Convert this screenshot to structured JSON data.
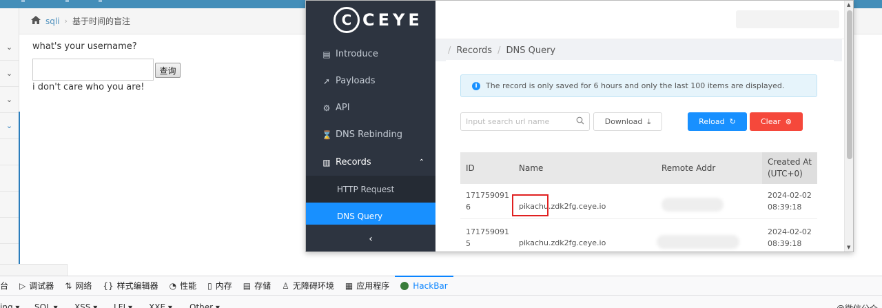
{
  "pikachu": {
    "breadcrumb": {
      "home_icon": "home-icon",
      "link": "sqli",
      "separator": "›",
      "current": "基于时间的盲注"
    },
    "sidebar_chevrons": [
      "⌄",
      "⌄",
      "⌄",
      "⌄"
    ],
    "question": "what's your username?",
    "input_value": "",
    "submit_label": "查询",
    "result": "i don't care who you are!"
  },
  "ceye": {
    "logo_mark": "C",
    "logo_text": "CEYE",
    "nav": [
      {
        "label": "Introduce",
        "icon": "book-icon"
      },
      {
        "label": "Payloads",
        "icon": "rocket-icon"
      },
      {
        "label": "API",
        "icon": "api-icon"
      },
      {
        "label": "DNS Rebinding",
        "icon": "hourglass-icon"
      },
      {
        "label": "Records",
        "icon": "records-icon"
      }
    ],
    "records_caret": "⌃",
    "subnav": {
      "http": "HTTP Request",
      "dns": "DNS Query"
    },
    "collapse_label": "‹",
    "crumb": {
      "sep": "/",
      "records": "Records",
      "current": "DNS Query"
    },
    "info_text": "The record is only saved for 6 hours and only the last 100 items are displayed.",
    "info_icon": "i",
    "search_placeholder": "Input search url name",
    "search_icon": "⌕",
    "download_label": "Download",
    "download_icon": "⤓",
    "reload_label": "Reload",
    "reload_icon": "↻",
    "clear_label": "Clear",
    "clear_icon": "⊗",
    "table": {
      "headers": {
        "id": "ID",
        "name": "Name",
        "addr": "Remote Addr",
        "created_line1": "Created At",
        "created_line2": "(UTC+0)"
      },
      "rows": [
        {
          "id_line1": "171759091",
          "id_line2": "6",
          "name": "pikachu.zdk2fg.ceye.io",
          "date": "2024-02-02",
          "time": "08:39:18"
        },
        {
          "id_line1": "171759091",
          "id_line2": "5",
          "name": "pikachu.zdk2fg.ceye.io",
          "date": "2024-02-02",
          "time": "08:39:18"
        }
      ]
    }
  },
  "devtools": {
    "tabs": [
      {
        "label": "台",
        "icon": ""
      },
      {
        "label": "调试器",
        "icon": "▷"
      },
      {
        "label": "网络",
        "icon": "⇅"
      },
      {
        "label": "样式编辑器",
        "icon": "{}"
      },
      {
        "label": "性能",
        "icon": "◔"
      },
      {
        "label": "内存",
        "icon": "▯"
      },
      {
        "label": "存储",
        "icon": "▤"
      },
      {
        "label": "无障碍环境",
        "icon": "♙"
      },
      {
        "label": "应用程序",
        "icon": "▦"
      },
      {
        "label": "HackBar",
        "icon": ""
      }
    ],
    "hackbar_items": [
      "ing ▾",
      "SQL ▾",
      "XSS ▾",
      "LFI ▾",
      "XXE ▾",
      "Other ▾",
      "@微信公众"
    ]
  }
}
